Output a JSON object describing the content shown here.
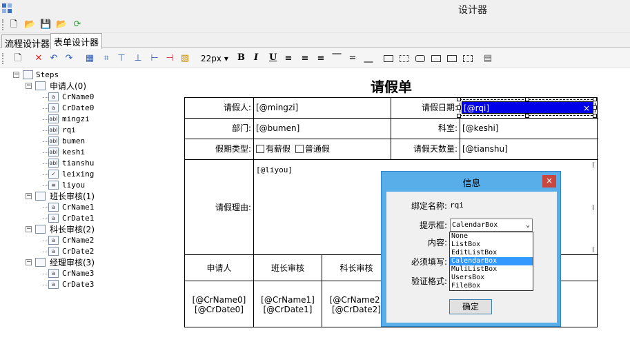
{
  "window": {
    "title": "设计器"
  },
  "tabs": [
    {
      "label": "流程设计器"
    },
    {
      "label": "表单设计器"
    }
  ],
  "toolbar": {
    "font_size": "22px",
    "bold": "B",
    "italic": "I",
    "underline": "U"
  },
  "tree": {
    "root": "Steps",
    "groups": [
      {
        "label": "申请人(0)",
        "items": [
          "CrName0",
          "CrDate0",
          "mingzi",
          "rqi",
          "bumen",
          "keshi",
          "tianshu",
          "leixing",
          "liyou"
        ]
      },
      {
        "label": "班长审核(1)",
        "items": [
          "CrName1",
          "CrDate1"
        ]
      },
      {
        "label": "科长审核(2)",
        "items": [
          "CrName2",
          "CrDate2"
        ]
      },
      {
        "label": "经理审核(3)",
        "items": [
          "CrName3",
          "CrDate3"
        ]
      }
    ]
  },
  "form": {
    "title": "请假单",
    "rows": {
      "applicant_label": "请假人:",
      "applicant_value": "[@mingzi]",
      "date_label": "请假日期:",
      "date_value": "[@rqi]",
      "date_clear": "×",
      "dept_label": "部门:",
      "dept_value": "[@bumen]",
      "section_label": "科室:",
      "section_value": "[@keshi]",
      "type_label": "假期类型:",
      "type_opt1": "有薪假",
      "type_opt2": "普通假",
      "days_label": "请假天数量:",
      "days_value": "[@tianshu]",
      "reason_label": "请假理由:",
      "reason_value": "[@liyou]"
    },
    "approvals": [
      {
        "header": "申请人",
        "name": "[@CrName0]",
        "date": "[@CrDate0]"
      },
      {
        "header": "班长审核",
        "name": "[@CrName1]",
        "date": "[@CrDate1]"
      },
      {
        "header": "科长审核",
        "name": "[@CrName2]",
        "date": "[@CrDate2]"
      }
    ]
  },
  "dialog": {
    "title": "信息",
    "close": "×",
    "bind_label": "绑定名称:",
    "bind_value": "rqi",
    "hint_label": "提示框:",
    "hint_value": "CalendarBox",
    "content_label": "内容:",
    "required_label": "必须填写:",
    "validate_label": "验证格式:",
    "options": [
      "None",
      "ListBox",
      "EditListBox",
      "CalendarBox",
      "MuliListBox",
      "UsersBox",
      "FileBox"
    ],
    "selected_option": "CalendarBox",
    "ok": "确定"
  }
}
